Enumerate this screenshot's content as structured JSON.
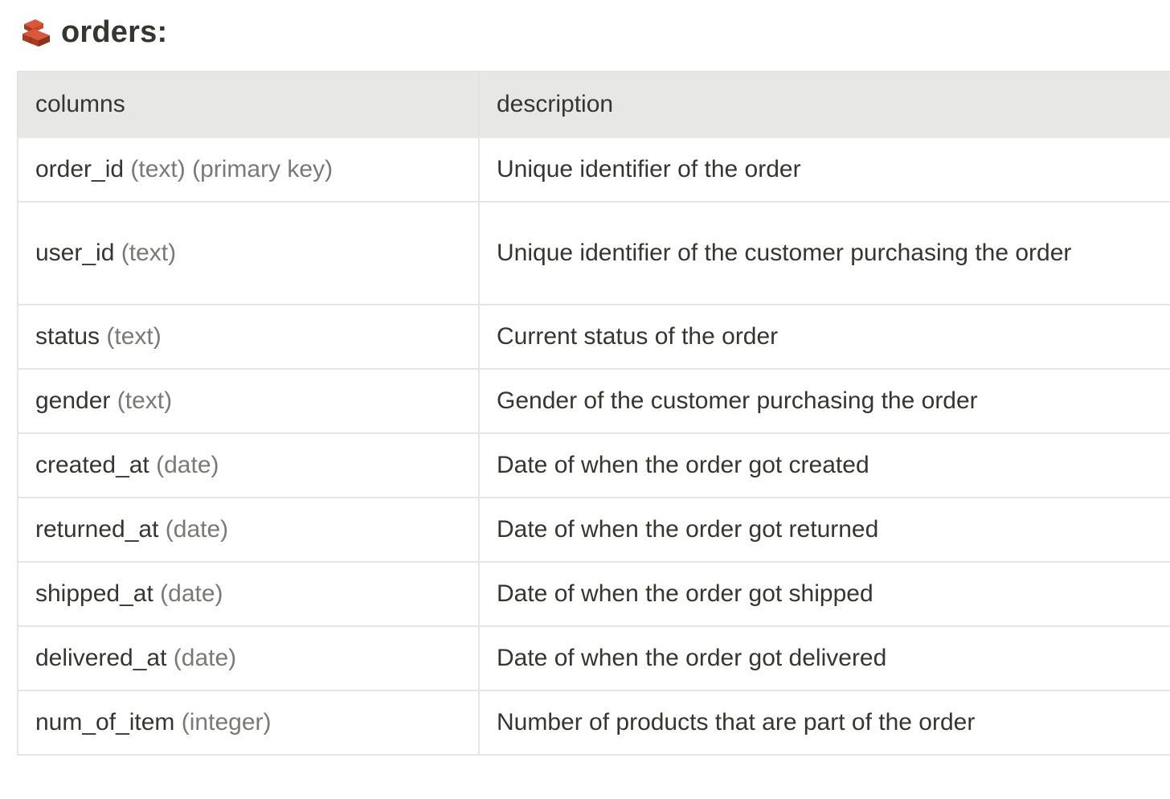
{
  "heading": {
    "icon": "bricks-icon",
    "title": "orders:"
  },
  "table": {
    "headers": {
      "columns": "columns",
      "description": "description"
    },
    "rows": [
      {
        "name": "order_id",
        "type": "(text) (primary key)",
        "description": "Unique identifier of the order"
      },
      {
        "name": "user_id",
        "type": "(text)",
        "description": "Unique identifier of the customer purchasing the order"
      },
      {
        "name": "status",
        "type": "(text)",
        "description": "Current status of the order"
      },
      {
        "name": "gender",
        "type": "(text)",
        "description": "Gender of the customer purchasing the order"
      },
      {
        "name": "created_at",
        "type": "(date)",
        "description": "Date of when the order got created"
      },
      {
        "name": "returned_at",
        "type": "(date)",
        "description": "Date of when the order got returned"
      },
      {
        "name": "shipped_at",
        "type": "(date)",
        "description": "Date of when the order got shipped"
      },
      {
        "name": "delivered_at",
        "type": "(date)",
        "description": "Date of when the order got delivered"
      },
      {
        "name": "num_of_item",
        "type": "(integer)",
        "description": "Number of products that are part of the order"
      }
    ]
  },
  "colors": {
    "header_bg": "#e7e7e6",
    "border": "#e6e6e4",
    "text": "#37352f",
    "muted": "#7a7976"
  }
}
